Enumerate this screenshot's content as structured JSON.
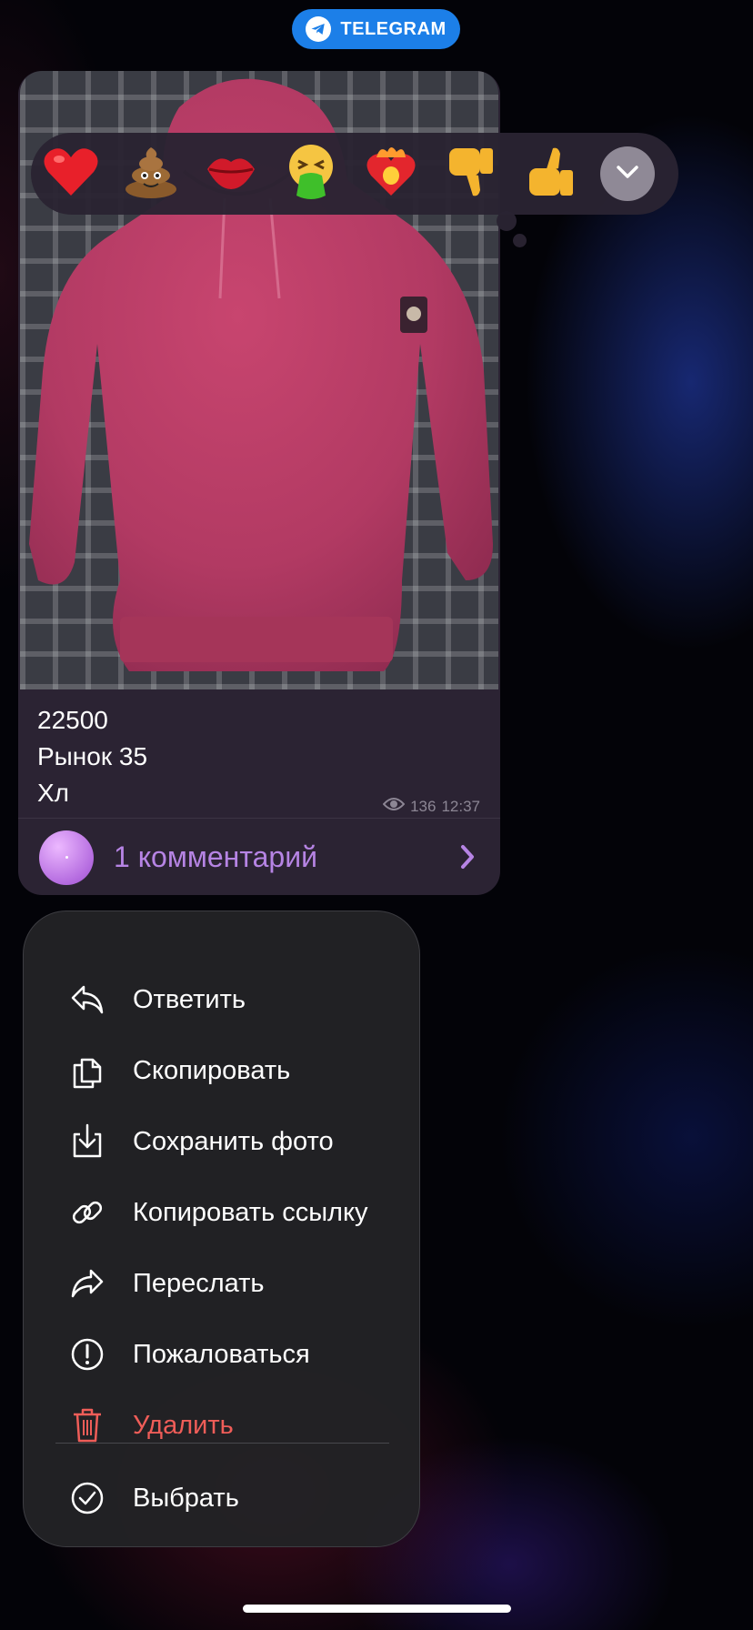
{
  "status_pill": {
    "label": "TELEGRAM",
    "color": "#1c7fe8"
  },
  "message": {
    "caption_lines": [
      "22500",
      "Рынок 35",
      "Хл"
    ],
    "views": "136",
    "time": "12:37",
    "comments_label": "1 комментарий"
  },
  "reactions": [
    {
      "icon": "red-heart-icon"
    },
    {
      "icon": "pile-of-poo-icon"
    },
    {
      "icon": "kiss-lips-icon"
    },
    {
      "icon": "vomiting-face-icon"
    },
    {
      "icon": "heart-on-fire-icon"
    },
    {
      "icon": "thumbs-down-icon"
    },
    {
      "icon": "thumbs-up-icon"
    },
    {
      "icon": "expand-chevron-icon"
    }
  ],
  "menu": {
    "items": [
      {
        "label": "Ответить",
        "icon": "reply-icon"
      },
      {
        "label": "Скопировать",
        "icon": "copy-icon"
      },
      {
        "label": "Сохранить фото",
        "icon": "save-photo-icon"
      },
      {
        "label": "Копировать ссылку",
        "icon": "link-icon"
      },
      {
        "label": "Переслать",
        "icon": "forward-icon"
      },
      {
        "label": "Пожаловаться",
        "icon": "report-icon"
      },
      {
        "label": "Удалить",
        "icon": "trash-icon",
        "destructive": true
      },
      {
        "label": "Выбрать",
        "icon": "select-check-icon"
      }
    ]
  },
  "colors": {
    "accent": "#b684e4",
    "danger": "#ef5d58",
    "bubble": "#2b2333"
  }
}
